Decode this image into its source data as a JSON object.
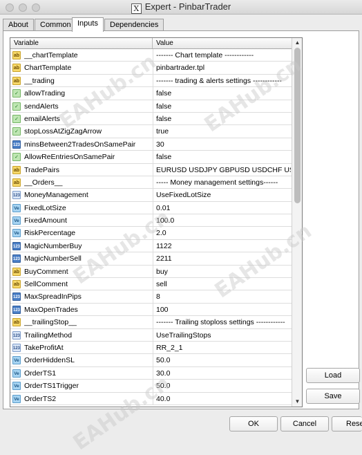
{
  "window": {
    "title": "Expert - PinbarTrader"
  },
  "tabs": [
    "About",
    "Common",
    "Inputs",
    "Dependencies"
  ],
  "grid": {
    "headers": {
      "variable": "Variable",
      "value": "Value"
    },
    "rows": [
      {
        "icon": "ab",
        "name": "__chartTemplate",
        "value": "------- Chart template ------------"
      },
      {
        "icon": "ab",
        "name": "ChartTemplate",
        "value": "pinbartrader.tpl"
      },
      {
        "icon": "ab",
        "name": "__trading",
        "value": "------- trading & alerts settings ------------"
      },
      {
        "icon": "bool",
        "name": "allowTrading",
        "value": "false"
      },
      {
        "icon": "bool",
        "name": "sendAlerts",
        "value": "false"
      },
      {
        "icon": "bool",
        "name": "emailAlerts",
        "value": "false"
      },
      {
        "icon": "bool",
        "name": "stopLossAtZigZagArrow",
        "value": "true"
      },
      {
        "icon": "123",
        "name": "minsBetween2TradesOnSamePair",
        "value": "30"
      },
      {
        "icon": "bool",
        "name": "AllowReEntriesOnSamePair",
        "value": "false"
      },
      {
        "icon": "ab",
        "name": "TradePairs",
        "value": "EURUSD USDJPY GBPUSD USDCHF USDCA..."
      },
      {
        "icon": "ab",
        "name": "__Orders__",
        "value": "----- Money management settings------"
      },
      {
        "icon": "enum",
        "name": "MoneyManagement",
        "value": "UseFixedLotSize"
      },
      {
        "icon": "ve",
        "name": "FixedLotSize",
        "value": "0.01"
      },
      {
        "icon": "ve",
        "name": "FixedAmount",
        "value": "100.0"
      },
      {
        "icon": "ve",
        "name": "RiskPercentage",
        "value": "2.0"
      },
      {
        "icon": "123",
        "name": "MagicNumberBuy",
        "value": "1122"
      },
      {
        "icon": "123",
        "name": "MagicNumberSell",
        "value": "2211"
      },
      {
        "icon": "ab",
        "name": "BuyComment",
        "value": "buy"
      },
      {
        "icon": "ab",
        "name": "SellComment",
        "value": "sell"
      },
      {
        "icon": "123",
        "name": "MaxSpreadInPips",
        "value": "8"
      },
      {
        "icon": "123",
        "name": "MaxOpenTrades",
        "value": "100"
      },
      {
        "icon": "ab",
        "name": "__trailingStop__",
        "value": "------- Trailing stoploss settings ------------"
      },
      {
        "icon": "enum",
        "name": "TrailingMethod",
        "value": "UseTrailingStops"
      },
      {
        "icon": "enum",
        "name": "TakeProfitAt",
        "value": "RR_2_1"
      },
      {
        "icon": "ve",
        "name": "OrderHiddenSL",
        "value": "50.0"
      },
      {
        "icon": "ve",
        "name": "OrderTS1",
        "value": "30.0"
      },
      {
        "icon": "ve",
        "name": "OrderTS1Trigger",
        "value": "50.0"
      },
      {
        "icon": "ve",
        "name": "OrderTS2",
        "value": "40.0"
      }
    ]
  },
  "icon_glyphs": {
    "ab": "ab",
    "bool": "✓",
    "123": "123",
    "ve": "Ve",
    "enum": "123"
  },
  "buttons": {
    "load": "Load",
    "save": "Save",
    "ok": "OK",
    "cancel": "Cancel",
    "reset": "Reset"
  },
  "watermark": "EAHub.cn",
  "colors": {
    "ab_icon": "#f6d86a",
    "bool_icon": "#bfe6b3",
    "num_icon": "#4a7fc7",
    "double_icon": "#a7d4f2"
  }
}
